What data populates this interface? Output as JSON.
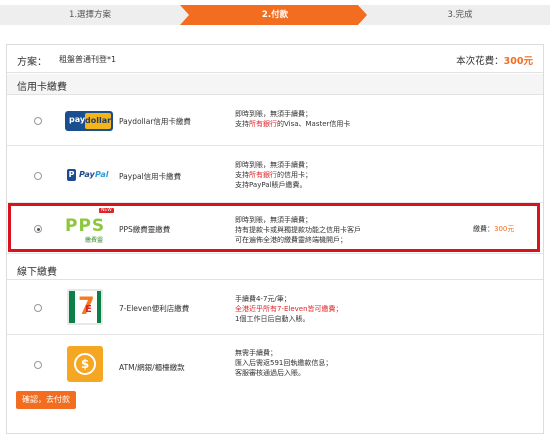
{
  "steps": [
    {
      "label": "1.選擇方案"
    },
    {
      "label": "2.付款"
    },
    {
      "label": "3.完成"
    }
  ],
  "plan": {
    "label": "方案：",
    "value": "租盤普通刊登*1",
    "total_label": "本次花費：",
    "total_amount": "300元"
  },
  "sections": {
    "credit": "信用卡繳費",
    "offline": "線下繳費"
  },
  "methods": [
    {
      "name": "Paydollar信用卡繳費",
      "logo": "paydollar",
      "desc_lines": [
        {
          "parts": [
            {
              "t": "即時到賬，無須手續費；"
            }
          ]
        },
        {
          "parts": [
            {
              "t": "支持"
            },
            {
              "t": "所有銀行",
              "hl": true
            },
            {
              "t": "的Visa、Master信用卡"
            }
          ]
        }
      ],
      "fee": "",
      "selected": false
    },
    {
      "name": "Paypal信用卡繳費",
      "logo": "paypal",
      "desc_lines": [
        {
          "parts": [
            {
              "t": "即時到賬，無須手續費；"
            }
          ]
        },
        {
          "parts": [
            {
              "t": "支持"
            },
            {
              "t": "所有銀行",
              "hl": true
            },
            {
              "t": "的信用卡；"
            }
          ]
        },
        {
          "parts": [
            {
              "t": "支持PayPal賬戶繳費。"
            }
          ]
        }
      ],
      "fee": "",
      "selected": false
    },
    {
      "name": "PPS繳費靈繳費",
      "logo": "pps",
      "badge": "NEW",
      "desc_lines": [
        {
          "parts": [
            {
              "t": "即時到賬，無須手續費；"
            }
          ]
        },
        {
          "parts": [
            {
              "t": "持有提款卡或與獨提款功能之信用卡客戶"
            }
          ]
        },
        {
          "parts": [
            {
              "t": "可在遍佈全港的繳費靈終端機開戶；"
            }
          ]
        }
      ],
      "fee_label": "繳費：",
      "fee_amount": "300元",
      "selected": true
    },
    {
      "name": "7-Eleven便利店繳費",
      "logo": "7eleven",
      "desc_lines": [
        {
          "parts": [
            {
              "t": "手續費4-7元/筆；"
            }
          ]
        },
        {
          "parts": [
            {
              "t": "全港近乎所有7-Eleven皆可繳費；",
              "hl": true
            }
          ]
        },
        {
          "parts": [
            {
              "t": "1個工作日后自動入賬。"
            }
          ]
        }
      ],
      "fee": "",
      "selected": false
    },
    {
      "name": "ATM/網銀/櫃檯繳款",
      "logo": "atm",
      "desc_lines": [
        {
          "parts": [
            {
              "t": "無需手續費；"
            }
          ]
        },
        {
          "parts": [
            {
              "t": "匯入后需返591回執繳款信息；"
            }
          ]
        },
        {
          "parts": [
            {
              "t": "客服審核通過后入賬。"
            }
          ]
        }
      ],
      "fee": "",
      "selected": false
    }
  ],
  "button": {
    "label": "確認，去付款"
  },
  "colors": {
    "accent": "#f26d20",
    "highlight": "#e0242a",
    "selected_border": "#d9131e"
  }
}
